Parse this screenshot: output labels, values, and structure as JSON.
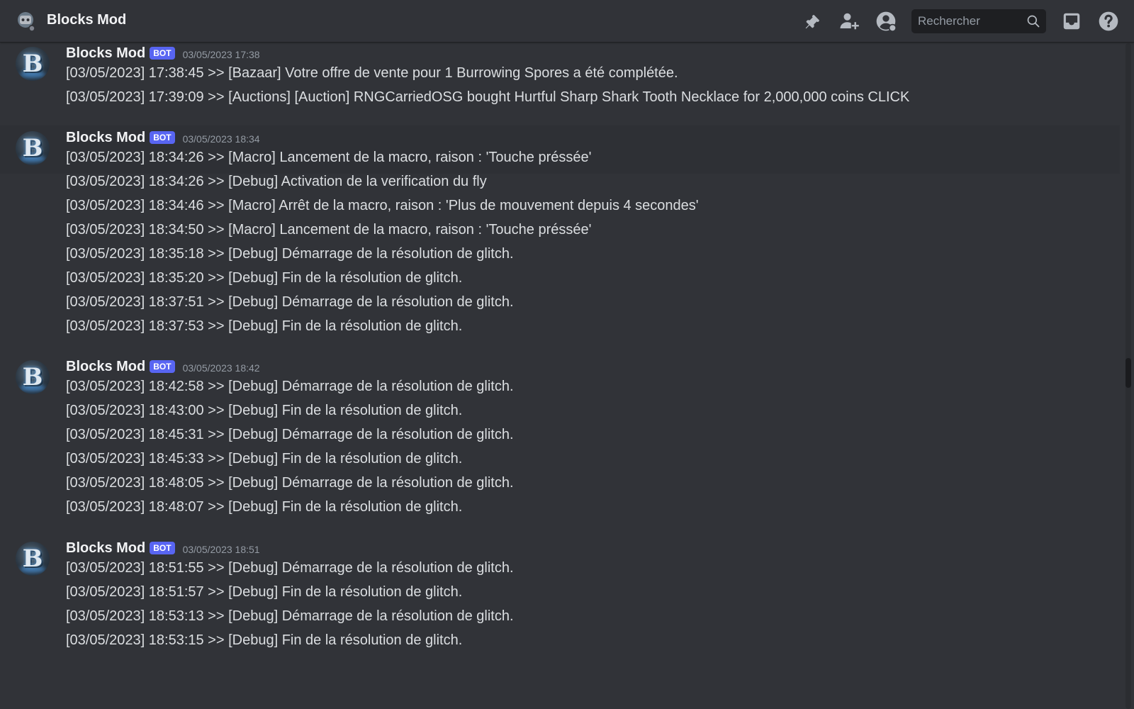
{
  "header": {
    "channel_title": "Blocks Mod",
    "search_placeholder": "Rechercher"
  },
  "toolbar": {
    "icons": [
      "pin-icon",
      "add-friend-icon",
      "user-profile-icon",
      "inbox-icon",
      "help-icon"
    ]
  },
  "colors": {
    "background": "#313338",
    "header_bg": "#313338",
    "bot_tag": "#5865f2",
    "username": "#f2f3f5",
    "text": "#dbdee1",
    "timestamp": "#949ba4",
    "search_bg": "#1e1f22"
  },
  "messages": [
    {
      "author": "Blocks Mod",
      "tag": "BOT",
      "timestamp": "03/05/2023 17:38",
      "lines": [
        "[03/05/2023] 17:38:45 >> [Bazaar] Votre offre de vente pour 1 Burrowing Spores a été complétée.",
        "[03/05/2023] 17:39:09 >> [Auctions] [Auction] RNGCarriedOSG bought Hurtful Sharp Shark Tooth Necklace for 2,000,000 coins CLICK"
      ]
    },
    {
      "author": "Blocks Mod",
      "tag": "BOT",
      "timestamp": "03/05/2023 18:34",
      "lines": [
        "[03/05/2023] 18:34:26 >> [Macro] Lancement de la macro, raison : 'Touche préssée'",
        "[03/05/2023] 18:34:26 >> [Debug] Activation de la verification du fly",
        "[03/05/2023] 18:34:46 >> [Macro] Arrêt de la macro, raison : 'Plus de mouvement depuis 4 secondes'",
        "[03/05/2023] 18:34:50 >> [Macro] Lancement de la macro, raison : 'Touche préssée'",
        "[03/05/2023] 18:35:18 >> [Debug] Démarrage de la résolution de glitch.",
        "[03/05/2023] 18:35:20 >> [Debug] Fin de la résolution de glitch.",
        "[03/05/2023] 18:37:51 >> [Debug] Démarrage de la résolution de glitch.",
        "[03/05/2023] 18:37:53 >> [Debug] Fin de la résolution de glitch."
      ]
    },
    {
      "author": "Blocks Mod",
      "tag": "BOT",
      "timestamp": "03/05/2023 18:42",
      "lines": [
        "[03/05/2023] 18:42:58 >> [Debug] Démarrage de la résolution de glitch.",
        "[03/05/2023] 18:43:00 >> [Debug] Fin de la résolution de glitch.",
        "[03/05/2023] 18:45:31 >> [Debug] Démarrage de la résolution de glitch.",
        "[03/05/2023] 18:45:33 >> [Debug] Fin de la résolution de glitch.",
        "[03/05/2023] 18:48:05 >> [Debug] Démarrage de la résolution de glitch.",
        "[03/05/2023] 18:48:07 >> [Debug] Fin de la résolution de glitch."
      ]
    },
    {
      "author": "Blocks Mod",
      "tag": "BOT",
      "timestamp": "03/05/2023 18:51",
      "lines": [
        "[03/05/2023] 18:51:55 >> [Debug] Démarrage de la résolution de glitch.",
        "[03/05/2023] 18:51:57 >> [Debug] Fin de la résolution de glitch.",
        "[03/05/2023] 18:53:13 >> [Debug] Démarrage de la résolution de glitch.",
        "[03/05/2023] 18:53:15 >> [Debug] Fin de la résolution de glitch."
      ]
    }
  ]
}
